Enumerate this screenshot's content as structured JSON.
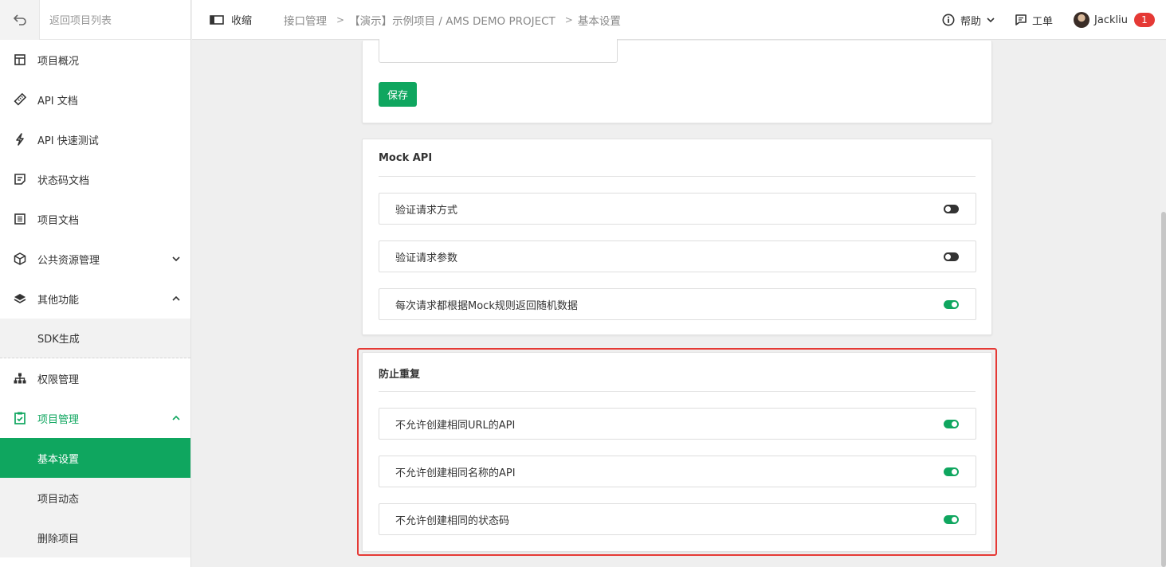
{
  "sidebar": {
    "back_label": "返回项目列表",
    "items": [
      {
        "label": "项目概况",
        "icon": "dashboard-icon"
      },
      {
        "label": "API 文档",
        "icon": "ruler-icon"
      },
      {
        "label": "API 快速测试",
        "icon": "bolt-icon"
      },
      {
        "label": "状态码文档",
        "icon": "note-icon"
      },
      {
        "label": "项目文档",
        "icon": "document-icon"
      },
      {
        "label": "公共资源管理",
        "icon": "cube-icon",
        "expanded": false
      },
      {
        "label": "其他功能",
        "icon": "layers-icon",
        "expanded": true
      },
      {
        "label": "权限管理",
        "icon": "hierarchy-icon"
      },
      {
        "label": "项目管理",
        "icon": "clipboard-check-icon",
        "expanded": true
      }
    ],
    "other_sub": [
      "SDK生成"
    ],
    "project_sub": [
      "基本设置",
      "项目动态",
      "删除项目"
    ],
    "active_sub": "基本设置"
  },
  "header": {
    "collapse_label": "收缩",
    "breadcrumb": [
      "接口管理",
      "【演示】示例项目 / AMS DEMO PROJECT",
      "基本设置"
    ],
    "help_label": "帮助",
    "ticket_label": "工单",
    "user_name": "Jackliu",
    "notification_count": "1"
  },
  "settings": {
    "save_label": "保存",
    "mock": {
      "title": "Mock API",
      "options": [
        {
          "label": "验证请求方式",
          "enabled": false
        },
        {
          "label": "验证请求参数",
          "enabled": false
        },
        {
          "label": "每次请求都根据Mock规则返回随机数据",
          "enabled": true
        }
      ]
    },
    "dedup": {
      "title": "防止重复",
      "options": [
        {
          "label": "不允许创建相同URL的API",
          "enabled": true
        },
        {
          "label": "不允许创建相同名称的API",
          "enabled": true
        },
        {
          "label": "不允许创建相同的状态码",
          "enabled": true
        }
      ]
    }
  },
  "colors": {
    "accent": "#0fa65f",
    "highlight": "#e53935",
    "badge": "#e53935"
  }
}
